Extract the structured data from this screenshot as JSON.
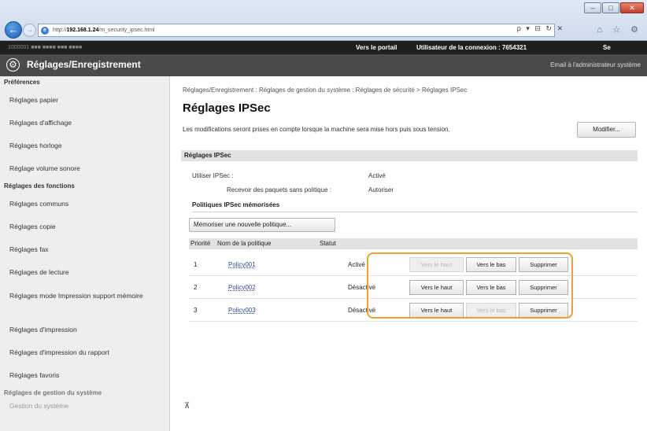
{
  "browser": {
    "url_prefix": "http://",
    "url_host": "192.168.1.24",
    "url_path": "/m_security_ipsec.html",
    "search_controls": "ρ ▾ ⊟ ↻ ✕",
    "toolbar_icons": "⌂ ☆ ⚙"
  },
  "device": {
    "name": "1000001   ■■■ ■■■■ ■■■ ■■■■",
    "portal_link": "Vers le portail",
    "user_label": "Utilisateur de la connexion : 7654321",
    "logout_link": "Se déconnecter"
  },
  "header": {
    "title": "Réglages/Enregistrement",
    "email_admin": "Email à l'administrateur système"
  },
  "sidebar": {
    "section_preferences": "Préférences",
    "preferences": [
      "Réglages papier",
      "Réglages d'affichage",
      "Réglages horloge",
      "Réglage volume sonore"
    ],
    "section_functions": "Réglages des fonctions",
    "functions": [
      "Réglages communs",
      "Réglages copie",
      "Réglages fax",
      "Réglages de lecture",
      "Réglages mode Impression support mémoire",
      "Réglages d'impression",
      "Réglages d'impression du rapport",
      "Réglages favoris"
    ],
    "section_system": "Réglages de gestion du système",
    "system": [
      "Gestion du système"
    ]
  },
  "main": {
    "breadcrumb": "Réglages/Enregistrement : Réglages de gestion du système : Réglages de sécurité > Réglages IPSec",
    "page_title": "Réglages IPSec",
    "note": "Les modifications seront prises en compte lorsque la machine sera mise hors puis sous tension.",
    "modify_button": "Modifier...",
    "section_title": "Réglages IPSec",
    "use_ipsec_label": "Utiliser IPSec :",
    "use_ipsec_value": "Activé",
    "receive_label": "Recevoir des paquets sans politique :",
    "receive_value": "Autoriser",
    "registered_policies_title": "Politiques IPSec mémorisées",
    "register_button": "Mémoriser une nouvelle politique...",
    "columns": {
      "priority": "Priorité",
      "name": "Nom de la politique",
      "status": "Statut"
    },
    "buttons": {
      "up": "Vers le haut",
      "down": "Vers le bas",
      "delete": "Supprimer"
    },
    "policies": [
      {
        "priority": "1",
        "name": "Policy001",
        "status": "Activé",
        "up_enabled": false,
        "down_enabled": true
      },
      {
        "priority": "2",
        "name": "Policy002",
        "status": "Désactivé",
        "up_enabled": true,
        "down_enabled": true
      },
      {
        "priority": "3",
        "name": "Policy003",
        "status": "Désactivé",
        "up_enabled": true,
        "down_enabled": false
      }
    ],
    "top_icon": "back-to-top-icon"
  },
  "colors": {
    "highlight": "#f0a12d",
    "link": "#2a4a9c",
    "header_bg": "#4a4a4a"
  }
}
